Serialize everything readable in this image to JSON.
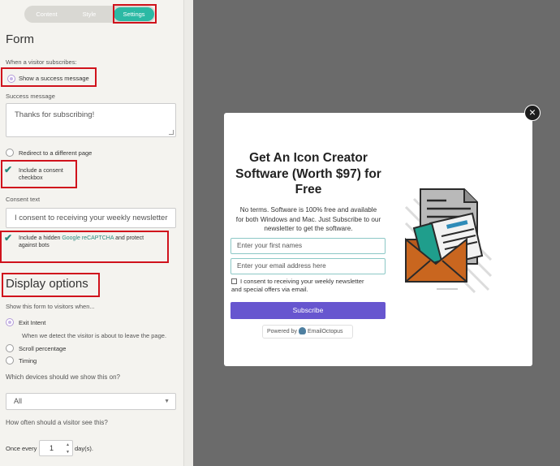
{
  "tabs": {
    "content": "Content",
    "style": "Style",
    "settings": "Settings"
  },
  "form": {
    "heading": "Form",
    "subscribe_label": "When a visitor subscribes:",
    "show_success": "Show a success message",
    "success_label": "Success message",
    "success_value": "Thanks for subscribing!",
    "redirect": "Redirect to a different page",
    "consent_checkbox_line1": "Include a consent",
    "consent_checkbox_line2": "checkbox",
    "consent_text_label": "Consent text",
    "consent_text_value": "I consent to receiving your weekly newsletter",
    "recaptcha_before": "Include a hidden ",
    "recaptcha_link": "Google reCAPTCHA",
    "recaptcha_after": " and protect",
    "recaptcha_line2": "against bots"
  },
  "display": {
    "heading": "Display options",
    "show_label": "Show this form to visitors when...",
    "exit_intent": "Exit Intent",
    "exit_desc": "When we detect the visitor is about to leave the page.",
    "scroll": "Scroll percentage",
    "timing": "Timing",
    "devices_label": "Which devices should we show this on?",
    "devices_value": "All",
    "freq_label": "How often should a visitor see this?",
    "once_every": "Once every",
    "days_value": "1",
    "days_unit": "day(s)."
  },
  "popup": {
    "title_line1": "Get An Icon Creator",
    "title_line2": "Software (Worth $97) for",
    "title_line3": "Free",
    "desc_line1": "No terms. Software is 100% free and available",
    "desc_line2": "for both Windows and Mac. Just Subscribe to our",
    "desc_line3": "newsletter to get the software.",
    "first_name_placeholder": "Enter your first names",
    "email_placeholder": "Enter your email address here",
    "consent_line1": "I consent to receiving your weekly newsletter",
    "consent_line2": "and special offers via email.",
    "subscribe_label": "Subscribe",
    "powered_by": "Powered by",
    "brand": "EmailOctopus",
    "close": "×"
  },
  "colors": {
    "accent": "#2bb9a4",
    "subscribe": "#6756cf",
    "highlight": "#d0121c"
  },
  "icons": [
    "close-icon",
    "check-icon",
    "envelope-illustration",
    "octopus-logo-icon",
    "caret-down-icon",
    "spinner-arrows-icon"
  ]
}
